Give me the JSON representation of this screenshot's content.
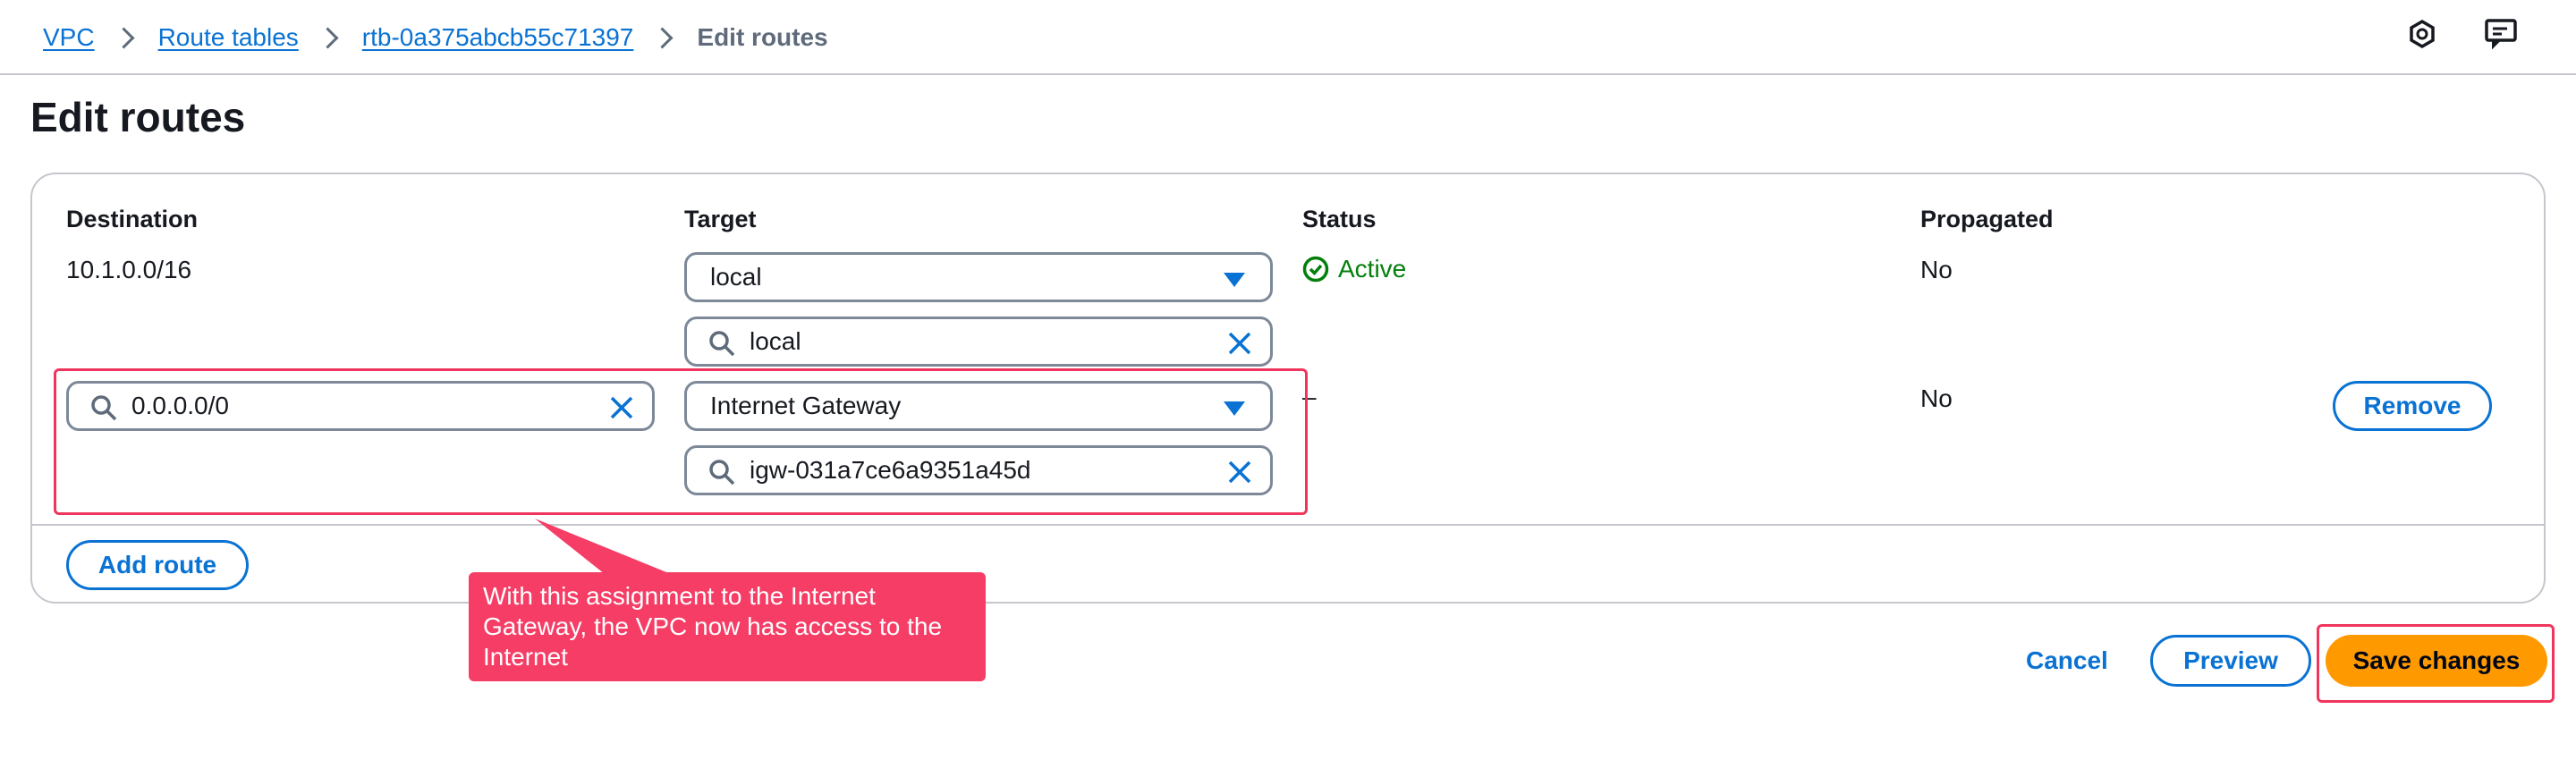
{
  "breadcrumb": {
    "items": [
      "VPC",
      "Route tables",
      "rtb-0a375abcb55c71397"
    ],
    "current": "Edit routes"
  },
  "page": {
    "title": "Edit routes"
  },
  "table": {
    "columns": [
      "Destination",
      "Target",
      "Status",
      "Propagated"
    ],
    "rows": [
      {
        "destination": "10.1.0.0/16",
        "target_type": "local",
        "target_search": "local",
        "status": "Active",
        "propagated": "No"
      },
      {
        "destination": "0.0.0.0/0",
        "target_type": "Internet Gateway",
        "target_search": "igw-031a7ce6a9351a45d",
        "status": "–",
        "propagated": "No",
        "remove_label": "Remove"
      }
    ],
    "add_route_label": "Add route"
  },
  "callout": {
    "text": "With this assignment to the Internet Gateway, the VPC now has access to the Internet"
  },
  "footer": {
    "cancel_label": "Cancel",
    "preview_label": "Preview",
    "save_label": "Save changes"
  },
  "colors": {
    "link": "#0972d3",
    "success": "#037f0c",
    "primary": "#ff9900",
    "highlight": "#f0355c",
    "callout": "#f53d66"
  },
  "icons": [
    "chevron-right-icon",
    "hexagon-icon",
    "feedback-icon",
    "caret-down-icon",
    "search-icon",
    "clear-icon",
    "check-circle-icon"
  ]
}
